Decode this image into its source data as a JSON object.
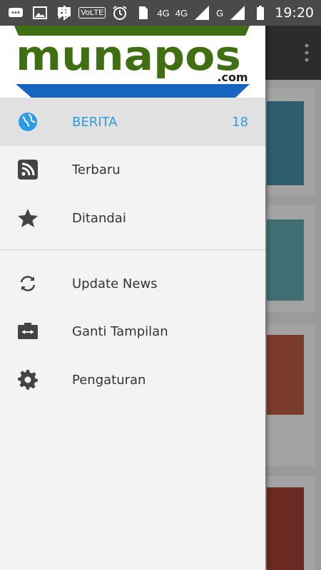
{
  "status_bar": {
    "network_badge": "VoLTE",
    "network_1": "4G",
    "network_2": "4G",
    "network_3": "G",
    "time": "19:20",
    "icons": [
      "message-icon",
      "image-icon",
      "bbm-icon",
      "bluetooth-icon",
      "alarm-icon",
      "sim-icon",
      "signal-icon",
      "battery-icon"
    ]
  },
  "header": {
    "logo_text": "munapos",
    "logo_suffix": ".com",
    "colors": {
      "logo_green": "#3f6f12",
      "logo_blue": "#1565c0"
    }
  },
  "drawer": {
    "items": [
      {
        "label": "BERITA",
        "count": "18",
        "icon": "globe-icon",
        "active": true
      },
      {
        "label": "Terbaru",
        "icon": "rss-icon"
      },
      {
        "label": "Ditandai",
        "icon": "star-icon"
      },
      {
        "label": "Update News",
        "icon": "sync-icon"
      },
      {
        "label": "Ganti Tampilan",
        "icon": "switch-view-icon"
      },
      {
        "label": "Pengaturan",
        "icon": "gear-icon"
      }
    ],
    "colors": {
      "active": "#2c9be6",
      "text": "#333333"
    }
  },
  "background_app": {
    "toolbar_icon": "more-vert-icon"
  }
}
